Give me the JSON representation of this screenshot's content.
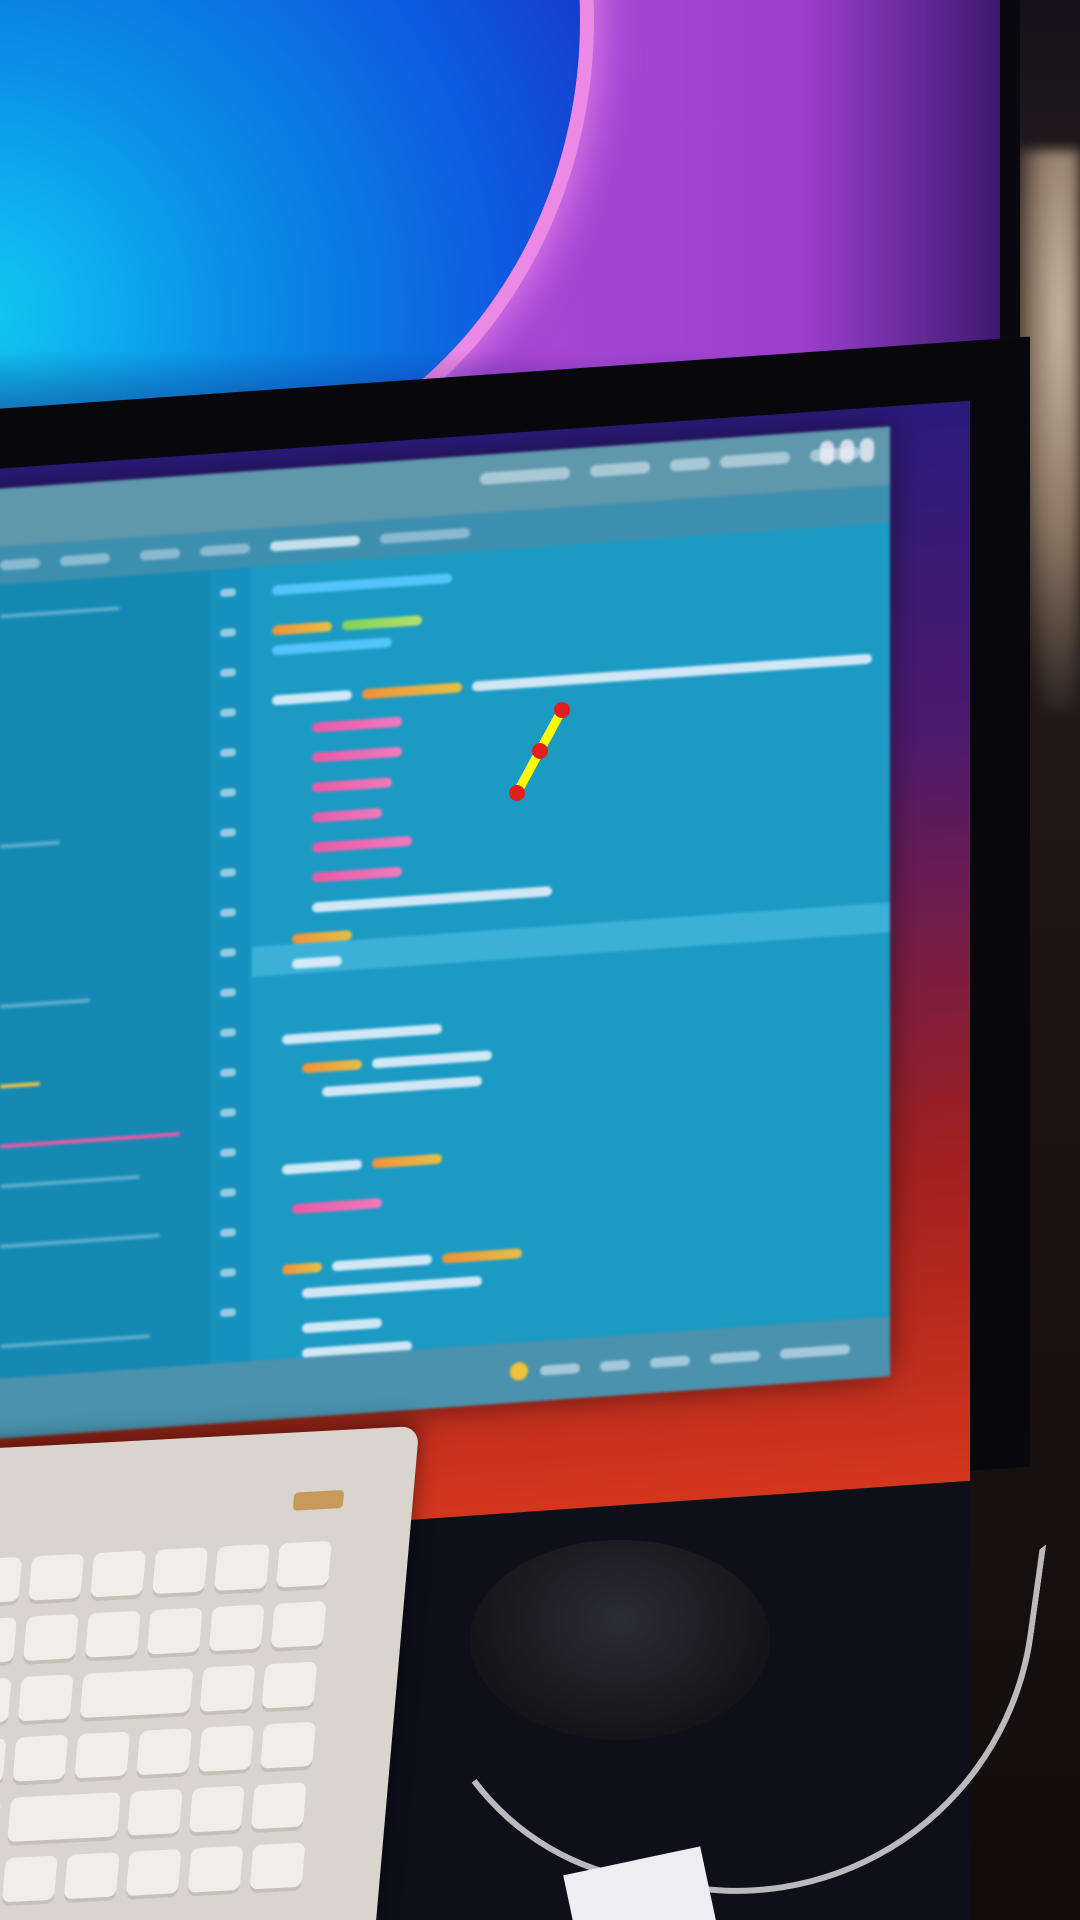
{
  "scene": {
    "description_colors": {
      "wallpaper_blue": "#0a8de6",
      "wallpaper_purple": "#a846d6",
      "ide_background": "#1b9ac4",
      "wallpaper_red": "#d3361d",
      "annotation_line": "#ffff00",
      "annotation_points": "#e0201a"
    }
  },
  "annotation": {
    "points": [
      {
        "x": 0.52,
        "y": 0.296
      },
      {
        "x": 0.5,
        "y": 0.313
      },
      {
        "x": 0.48,
        "y": 0.331
      }
    ]
  }
}
